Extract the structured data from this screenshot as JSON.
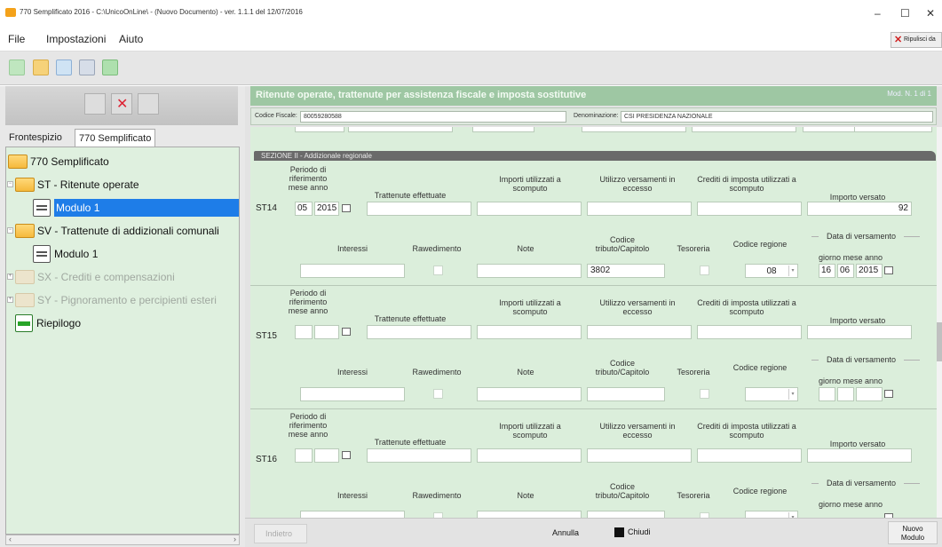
{
  "window": {
    "title": "770 Semplificato 2016 - C:\\UnicoOnLine\\ - (Nuovo Documento) - ver. 1.1.1 del 12/07/2016",
    "minimize": "–",
    "maximize": "☐",
    "close": "✕"
  },
  "menu": {
    "file": "File",
    "impostazioni": "Impostazioni",
    "aiuto": "Aiuto",
    "ripulisci": "Ripulisci da"
  },
  "tabs": {
    "frontespizio": "Frontespizio",
    "semplificato": "770 Semplificato"
  },
  "tree": {
    "root": "770 Semplificato",
    "st": "ST - Ritenute operate",
    "st_mod": "Modulo 1",
    "sv": "SV - Trattenute di addizionali comunali",
    "sv_mod": "Modulo 1",
    "sx": "SX - Crediti e compensazioni",
    "sy": "SY - Pignoramento e percipienti esteri",
    "riepilogo": "Riepilogo"
  },
  "header": {
    "banner": "Ritenute operate, trattenute per assistenza fiscale e imposta sostitutive",
    "modulo": "Mod. N. 1 di 1",
    "cf_label": "Codice Fiscale:",
    "cf_value": "80059280588",
    "den_label": "Denominazione:",
    "den_value": "CSI PRESIDENZA NAZIONALE"
  },
  "section": "SEZIONE II - Addizionale regionale",
  "labels": {
    "periodo": "Periodo di riferimento mese anno",
    "trattenute": "Trattenute effettuate",
    "importi": "Importi utilizzati a scomputo",
    "utilizzo": "Utilizzo versamenti in eccesso",
    "crediti": "Crediti di imposta utilizzati a scomputo",
    "versato": "Importo versato",
    "interessi": "Interessi",
    "ravvedimento": "Rawedimento",
    "note": "Note",
    "codice_tributo": "Codice tributo/Capitolo",
    "tesoreria": "Tesoreria",
    "codice_regione": "Codice regione",
    "data_vers": "Data di versamento",
    "gma": "giorno mese anno"
  },
  "rows": [
    {
      "id": "ST14",
      "mese": "05",
      "anno": "2015",
      "versato": "92",
      "codice_tributo": "3802",
      "regione": "08",
      "giorno": "16",
      "v_mese": "06",
      "v_anno": "2015"
    },
    {
      "id": "ST15",
      "mese": "",
      "anno": "",
      "versato": "",
      "codice_tributo": "",
      "regione": "",
      "giorno": "",
      "v_mese": "",
      "v_anno": ""
    },
    {
      "id": "ST16",
      "mese": "",
      "anno": "",
      "versato": "",
      "codice_tributo": "",
      "regione": "",
      "giorno": "",
      "v_mese": "",
      "v_anno": ""
    }
  ],
  "footer": {
    "indietro": "Indietro",
    "annulla": "Annulla",
    "chiudi": "Chiudi",
    "nuovo": "Nuovo Modulo"
  }
}
